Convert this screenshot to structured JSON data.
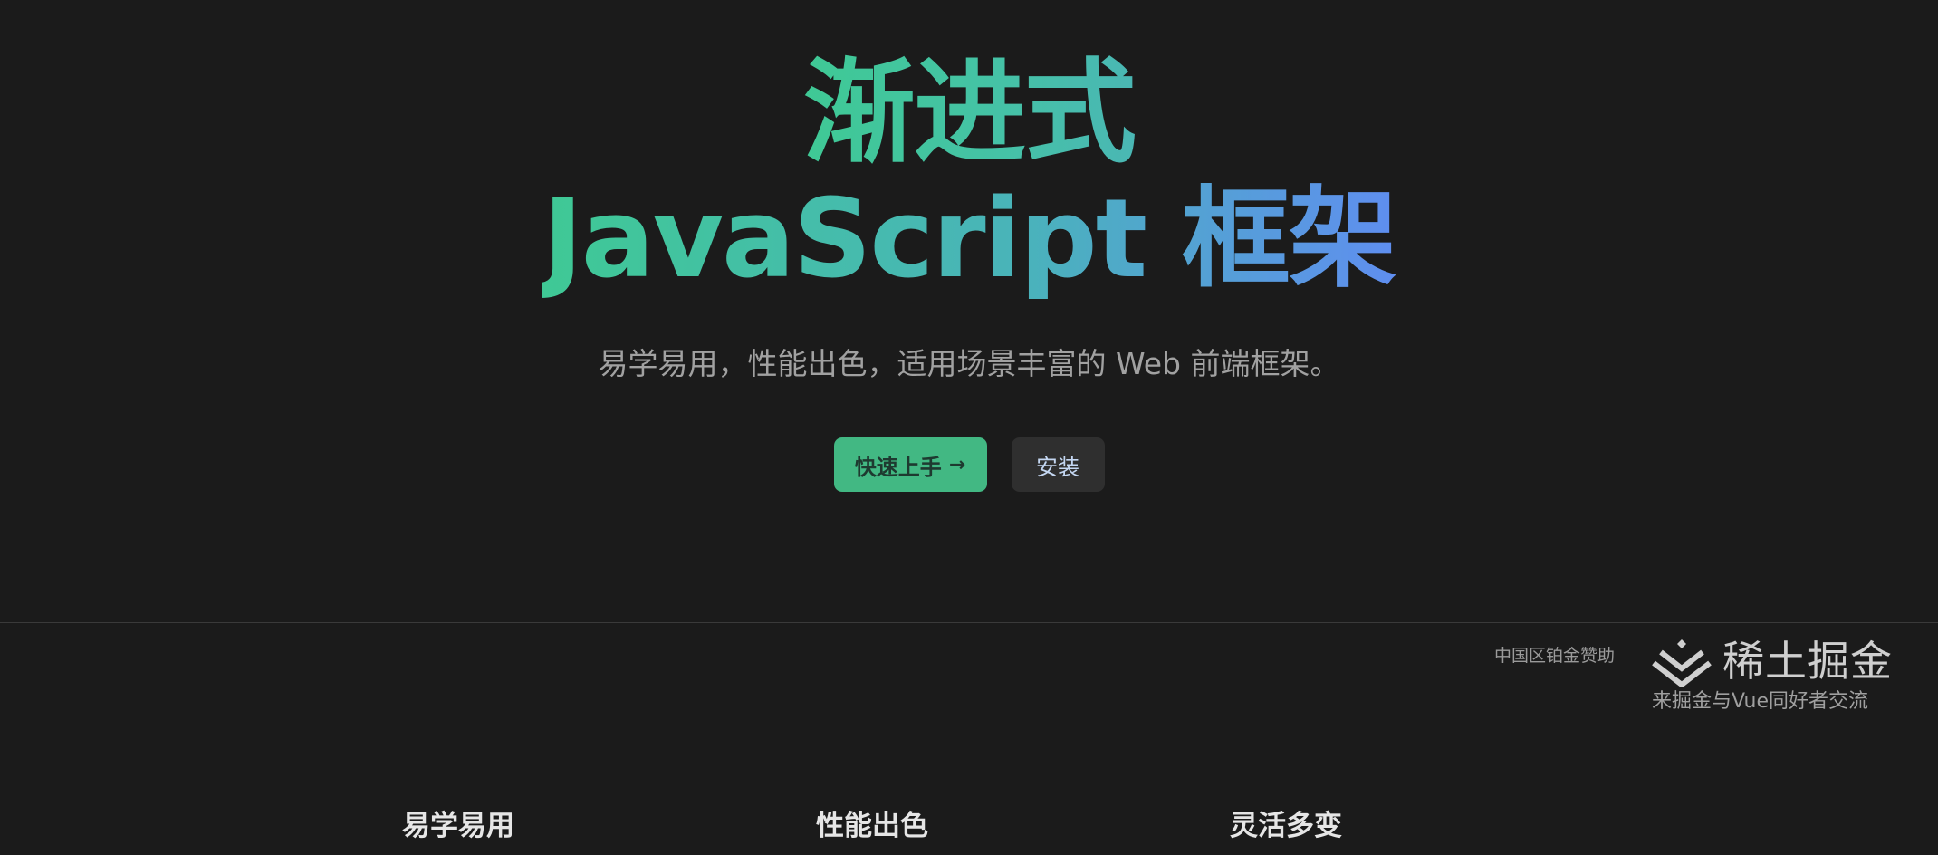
{
  "hero": {
    "title_line1": "渐进式",
    "title_line2": "JavaScript 框架",
    "subtitle": "易学易用，性能出色，适用场景丰富的 Web 前端框架。"
  },
  "actions": {
    "primary_label": "快速上手",
    "primary_icon": "arrow-right-icon",
    "secondary_label": "安装"
  },
  "sponsor": {
    "label": "中国区铂金赞助",
    "name": "稀土掘金",
    "slogan": "来掘金与Vue同好者交流",
    "icon": "juejin-logo-icon"
  },
  "features": [
    {
      "title": "易学易用"
    },
    {
      "title": "性能出色"
    },
    {
      "title": "灵活多变"
    }
  ],
  "colors": {
    "background": "#1b1b1b",
    "brand_green": "#42b883",
    "gradient_start": "#3fc995",
    "gradient_end": "#5f8ef0"
  }
}
